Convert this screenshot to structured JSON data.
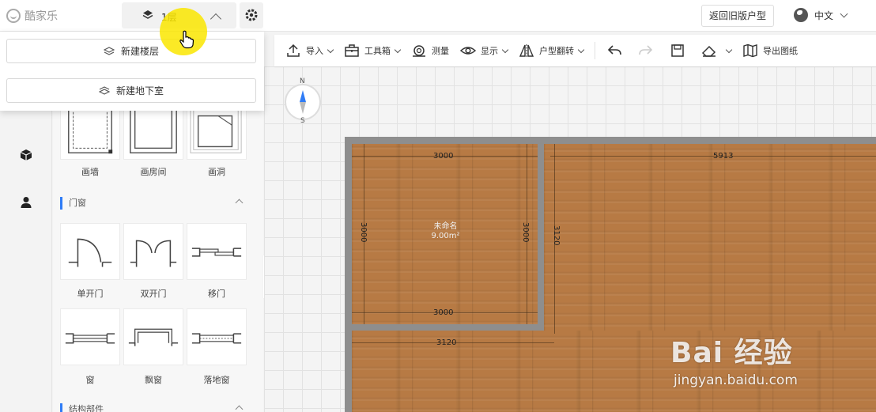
{
  "app": {
    "logo_text": "酷家乐"
  },
  "floor": {
    "current": "1层"
  },
  "header": {
    "old_version_button": "返回旧版户型",
    "language": "中文"
  },
  "dropdown": {
    "new_floor": "新建楼层",
    "new_basement": "新建地下室"
  },
  "panel": {
    "top_tiles": [
      {
        "label": "画墙"
      },
      {
        "label": "画房间"
      },
      {
        "label": "画洞"
      }
    ],
    "doors_section": "门窗",
    "door_tiles": [
      {
        "label": "单开门"
      },
      {
        "label": "双开门"
      },
      {
        "label": "移门"
      }
    ],
    "window_tiles": [
      {
        "label": "窗"
      },
      {
        "label": "飘窗"
      },
      {
        "label": "落地窗"
      }
    ],
    "next_section": "结构部件"
  },
  "toolbar": {
    "import": "导入",
    "toolbox": "工具箱",
    "measure": "测量",
    "display": "显示",
    "flip": "户型翻转",
    "export": "导出图纸"
  },
  "compass": {
    "north": "N",
    "south": "S"
  },
  "plan": {
    "room1_name": "未命名",
    "room1_area": "9.00m²",
    "dim_top_left": "3000",
    "dim_top_right": "5913",
    "dim_left": "3000",
    "dim_room_right": "3000",
    "dim_vertical_right": "3120",
    "dim_bottom": "3000",
    "dim_lower": "3120"
  },
  "watermark": {
    "brand": "Bai 经验",
    "url": "jingyan.baidu.com"
  },
  "colors": {
    "accent": "#2f7cf6",
    "floor_wood": "#b77a44",
    "wall": "#8e8e8e",
    "highlight": "#fae600"
  }
}
